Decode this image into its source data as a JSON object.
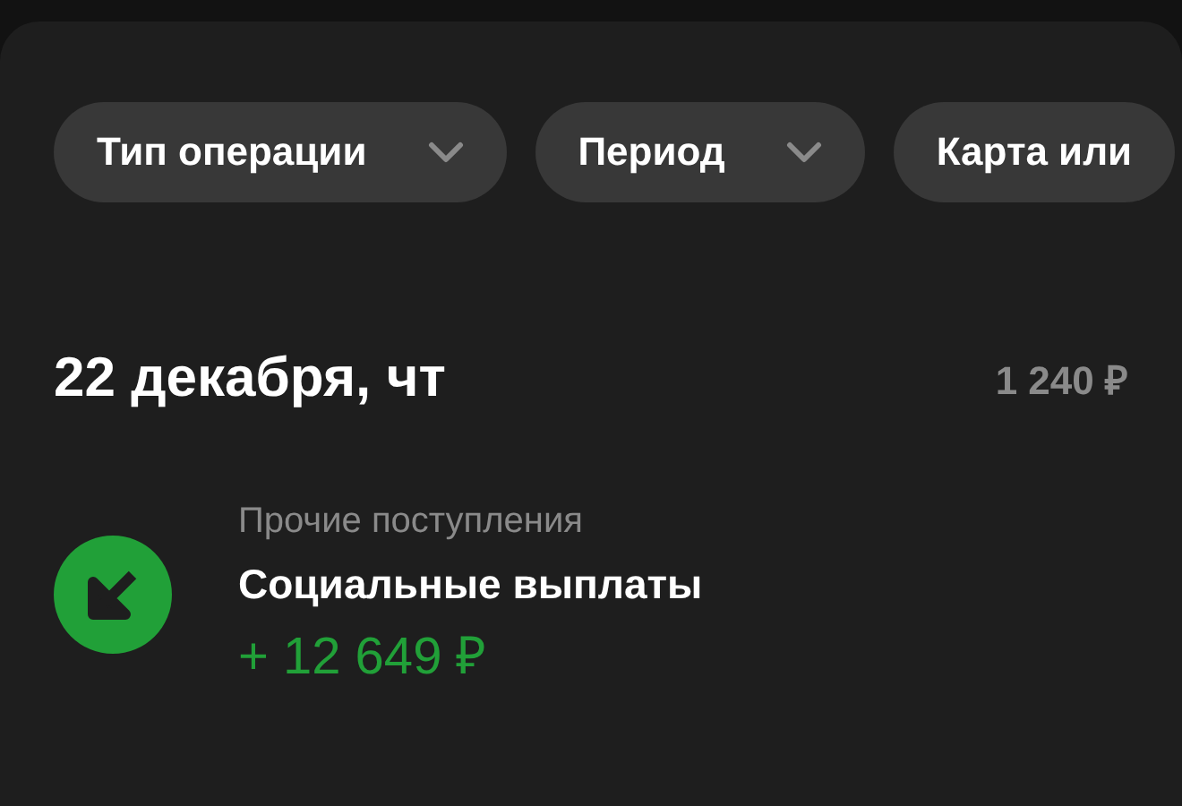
{
  "filters": [
    {
      "label": "Тип операции",
      "chevron": true
    },
    {
      "label": "Период",
      "chevron": true
    },
    {
      "label": "Карта или",
      "chevron": false
    }
  ],
  "day": {
    "date": "22 декабря, чт",
    "total": "1 240 ₽"
  },
  "operations": [
    {
      "kind": "income",
      "category": "Прочие поступления",
      "title": "Социальные выплаты",
      "amount": "+ 12 649 ₽"
    }
  ]
}
